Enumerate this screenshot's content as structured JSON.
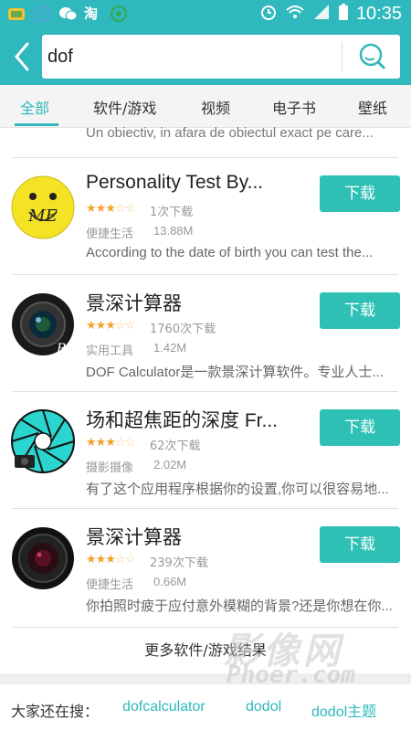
{
  "status_bar": {
    "time": "10:35",
    "icons": [
      "notification-app-icon",
      "cloud-icon",
      "wechat-icon",
      "taobao-icon",
      "app-icon",
      "alarm-icon",
      "wifi-icon",
      "signal-icon",
      "battery-icon"
    ]
  },
  "search": {
    "query": "dof",
    "back_icon": "chevron-left-icon",
    "search_icon": "search-icon"
  },
  "tabs": [
    {
      "label": "全部",
      "active": true
    },
    {
      "label": "软件/游戏",
      "active": false
    },
    {
      "label": "视频",
      "active": false
    },
    {
      "label": "电子书",
      "active": false
    },
    {
      "label": "壁纸",
      "active": false
    }
  ],
  "partial_previous": "Un obiectiv, in afara de obiectul exact pe care...",
  "apps": [
    {
      "name": "Personality Test By...",
      "rating_stars": 3,
      "downloads": "1次下载",
      "category": "便捷生活",
      "size": "13.88M",
      "description": "According to the date of birth you can test the...",
      "button": "下载"
    },
    {
      "name": "景深计算器",
      "rating_stars": 3,
      "downloads": "1760次下载",
      "category": "实用工具",
      "size": "1.42M",
      "description": "DOF Calculator是一款景深计算软件。专业人士...",
      "button": "下载"
    },
    {
      "name": "场和超焦距的深度 Fr...",
      "rating_stars": 3,
      "downloads": "62次下载",
      "category": "摄影摄像",
      "size": "2.02M",
      "description": "有了这个应用程序根据你的设置,你可以很容易地...",
      "button": "下载"
    },
    {
      "name": "景深计算器",
      "rating_stars": 3,
      "downloads": "239次下载",
      "category": "便捷生活",
      "size": "0.66M",
      "description": "你拍照时疲于应付意外模糊的背景?还是你想在你...",
      "button": "下载"
    }
  ],
  "more_results": "更多软件/游戏结果",
  "hot_searches": {
    "label": "大家还在搜：",
    "keywords": [
      "dofcalculator",
      "dodol",
      "dodol主题"
    ]
  },
  "watermark": {
    "cn": "影像网",
    "en": "Phoer.com"
  },
  "colors": {
    "accent": "#2fb8bd",
    "button": "#2fc0b5",
    "star": "#f2a22a"
  }
}
